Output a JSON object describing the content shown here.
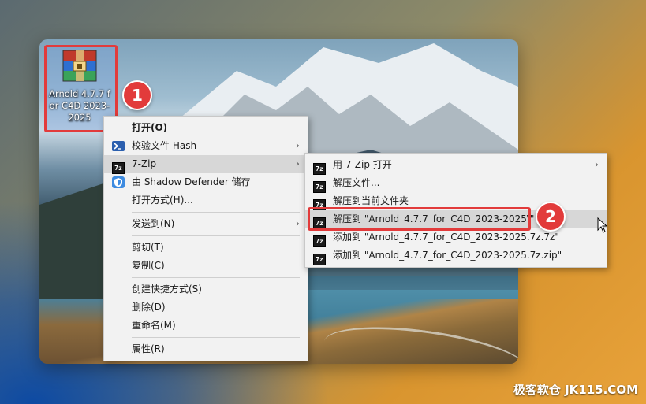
{
  "desktop_icon": {
    "label": "Arnold 4.7.7 for C4D 2023-2025",
    "icon": "winrar-archive-icon"
  },
  "badges": [
    "1",
    "2"
  ],
  "context_menu": {
    "items": [
      {
        "label": "打开(O)",
        "icon": "",
        "bold": true
      },
      {
        "label": "校验文件 Hash",
        "icon": "powershell-icon",
        "submenu": true
      },
      {
        "label": "7-Zip",
        "icon": "7zip-icon",
        "submenu": true,
        "highlighted": true
      },
      {
        "label": "由 Shadow Defender 储存",
        "icon": "shadow-defender-icon"
      },
      {
        "label": "打开方式(H)...",
        "icon": ""
      },
      {
        "label": "发送到(N)",
        "icon": "",
        "submenu": true
      },
      {
        "label": "剪切(T)",
        "icon": ""
      },
      {
        "label": "复制(C)",
        "icon": ""
      },
      {
        "label": "创建快捷方式(S)",
        "icon": ""
      },
      {
        "label": "删除(D)",
        "icon": ""
      },
      {
        "label": "重命名(M)",
        "icon": ""
      },
      {
        "label": "属性(R)",
        "icon": ""
      }
    ]
  },
  "submenu_7zip": {
    "icon_text": "7z",
    "items": [
      {
        "label": "用 7-Zip 打开",
        "submenu": true
      },
      {
        "label": "解压文件..."
      },
      {
        "label": "解压到当前文件夹"
      },
      {
        "label": "解压到 \"Arnold_4.7.7_for_C4D_2023-2025\\\"",
        "highlighted": true
      },
      {
        "label": "添加到 \"Arnold_4.7.7_for_C4D_2023-2025.7z.7z\""
      },
      {
        "label": "添加到 \"Arnold_4.7.7_for_C4D_2023-2025.7z.zip\""
      }
    ]
  },
  "arrow_glyph": "›",
  "watermark": "极客软仓 JK115.COM",
  "colors": {
    "highlight_red": "#e23b3b",
    "menu_bg": "#f2f2f2",
    "menu_hover": "#d7d7d7"
  }
}
